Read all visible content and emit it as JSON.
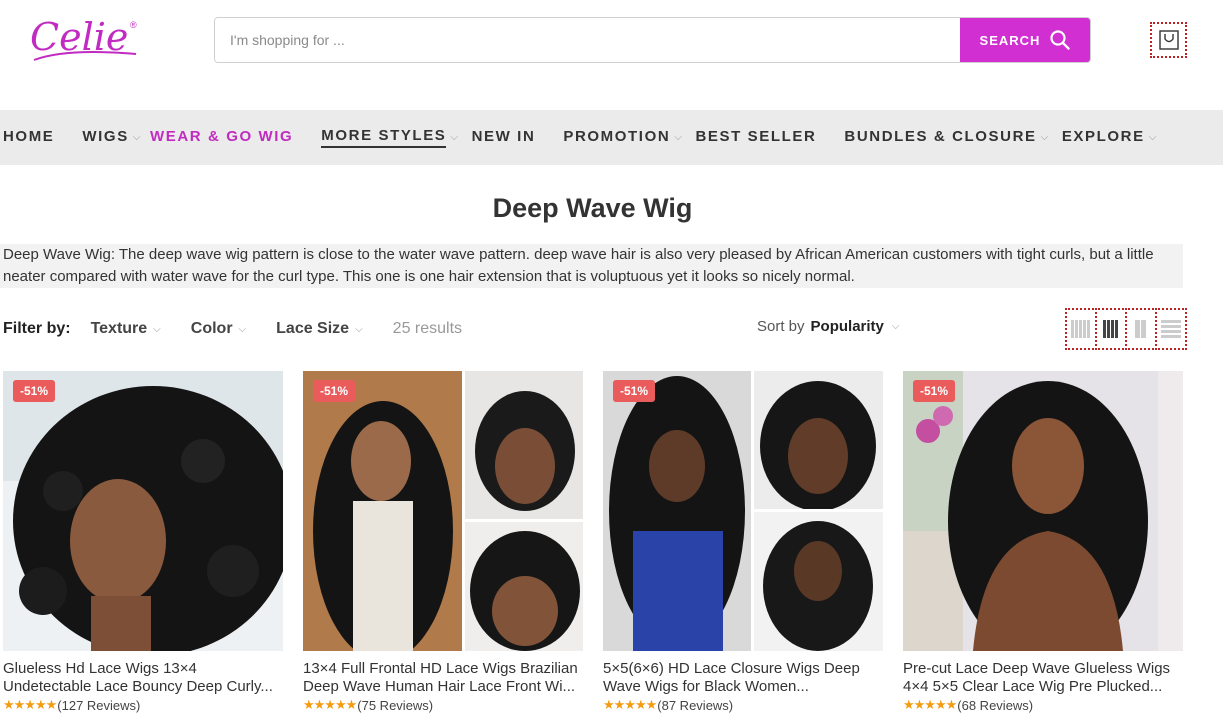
{
  "brand": {
    "logo_text": "Celie",
    "trademark": "®",
    "color": "#c12bc1"
  },
  "search": {
    "placeholder": "I'm shopping for ...",
    "button_label": "SEARCH"
  },
  "nav": {
    "items": [
      {
        "label": "HOME",
        "chevron": false
      },
      {
        "label": "WIGS",
        "chevron": true
      },
      {
        "label": "WEAR & GO WIG",
        "chevron": false,
        "active": true
      },
      {
        "label": "MORE STYLES",
        "chevron": true,
        "underlined": true
      },
      {
        "label": "NEW IN",
        "chevron": false
      },
      {
        "label": "PROMOTION",
        "chevron": true
      },
      {
        "label": "BEST SELLER",
        "chevron": false
      },
      {
        "label": "BUNDLES & CLOSURE",
        "chevron": true
      },
      {
        "label": "EXPLORE",
        "chevron": true
      }
    ]
  },
  "page": {
    "title": "Deep Wave Wig",
    "description": "Deep Wave Wig: The deep wave wig pattern is close to the water wave pattern. deep wave hair is also very pleased by African American customers with tight curls, but a little neater compared with water wave for the curl type. This one is one hair extension that is voluptuous yet it looks so nicely normal."
  },
  "filters": {
    "label": "Filter by:",
    "options": [
      "Texture",
      "Color",
      "Lace Size"
    ],
    "results": "25 results",
    "sort_label": "Sort by",
    "sort_value": "Popularity"
  },
  "products": [
    {
      "badge": "-51%",
      "title": "Glueless Hd Lace Wigs 13×4 Undetectable Lace Bouncy Deep Curly...",
      "stars": "★★★★★",
      "reviews": "(127 Reviews)"
    },
    {
      "badge": "-51%",
      "title": "13×4 Full Frontal HD Lace Wigs Brazilian Deep Wave Human Hair Lace Front Wi...",
      "stars": "★★★★★",
      "reviews": "(75 Reviews)"
    },
    {
      "badge": "-51%",
      "title": "5×5(6×6) HD Lace Closure Wigs Deep Wave Wigs for Black Women...",
      "stars": "★★★★★",
      "reviews": "(87 Reviews)"
    },
    {
      "badge": "-51%",
      "title": "Pre-cut Lace Deep Wave Glueless Wigs 4×4 5×5 Clear Lace Wig Pre Plucked...",
      "stars": "★★★★★",
      "reviews": "(68 Reviews)"
    }
  ],
  "colors": {
    "accent": "#d12fd1",
    "badge": "#ea5b5b",
    "star": "#f39c12",
    "nav_bg": "#ebebeb"
  }
}
